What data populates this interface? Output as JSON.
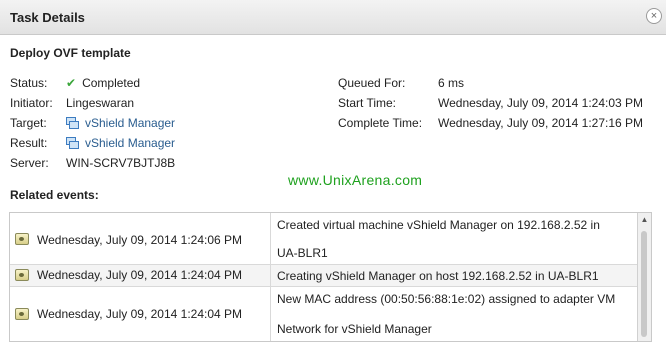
{
  "dialog": {
    "title": "Task Details",
    "close_icon": "close-icon",
    "close_glyph": "×"
  },
  "task": {
    "name": "Deploy OVF template",
    "fields": {
      "status_label": "Status:",
      "status_value": "Completed",
      "status_icon": "check-icon",
      "initiator_label": "Initiator:",
      "initiator_value": "Lingeswaran",
      "target_label": "Target:",
      "target_value": "vShield Manager",
      "result_label": "Result:",
      "result_value": "vShield Manager",
      "server_label": "Server:",
      "server_value": "WIN-SCRV7BJTJ8B",
      "queued_label": "Queued For:",
      "queued_value": "6 ms",
      "start_label": "Start Time:",
      "start_value": "Wednesday, July 09, 2014 1:24:03 PM",
      "complete_label": "Complete Time:",
      "complete_value": "Wednesday, July 09, 2014 1:27:16 PM"
    }
  },
  "watermark": "www.UnixArena.com",
  "events": {
    "title": "Related events:",
    "rows": [
      {
        "time": "Wednesday, July 09, 2014 1:24:06 PM",
        "line1": "Created virtual machine  vShield Manager  on  192.168.2.52  in",
        "line2": "UA-BLR1"
      },
      {
        "time": "Wednesday, July 09, 2014 1:24:04 PM",
        "line1": "Creating  vShield Manager  on host  192.168.2.52  in  UA-BLR1",
        "line2": ""
      },
      {
        "time": "Wednesday, July 09, 2014 1:24:04 PM",
        "line1": "New MAC address (00:50:56:88:1e:02) assigned to adapter VM",
        "line2": "Network for  vShield Manager"
      }
    ]
  },
  "colors": {
    "link": "#2a5d8f",
    "status_ok": "#3aa63a",
    "watermark": "#1ea11e"
  }
}
